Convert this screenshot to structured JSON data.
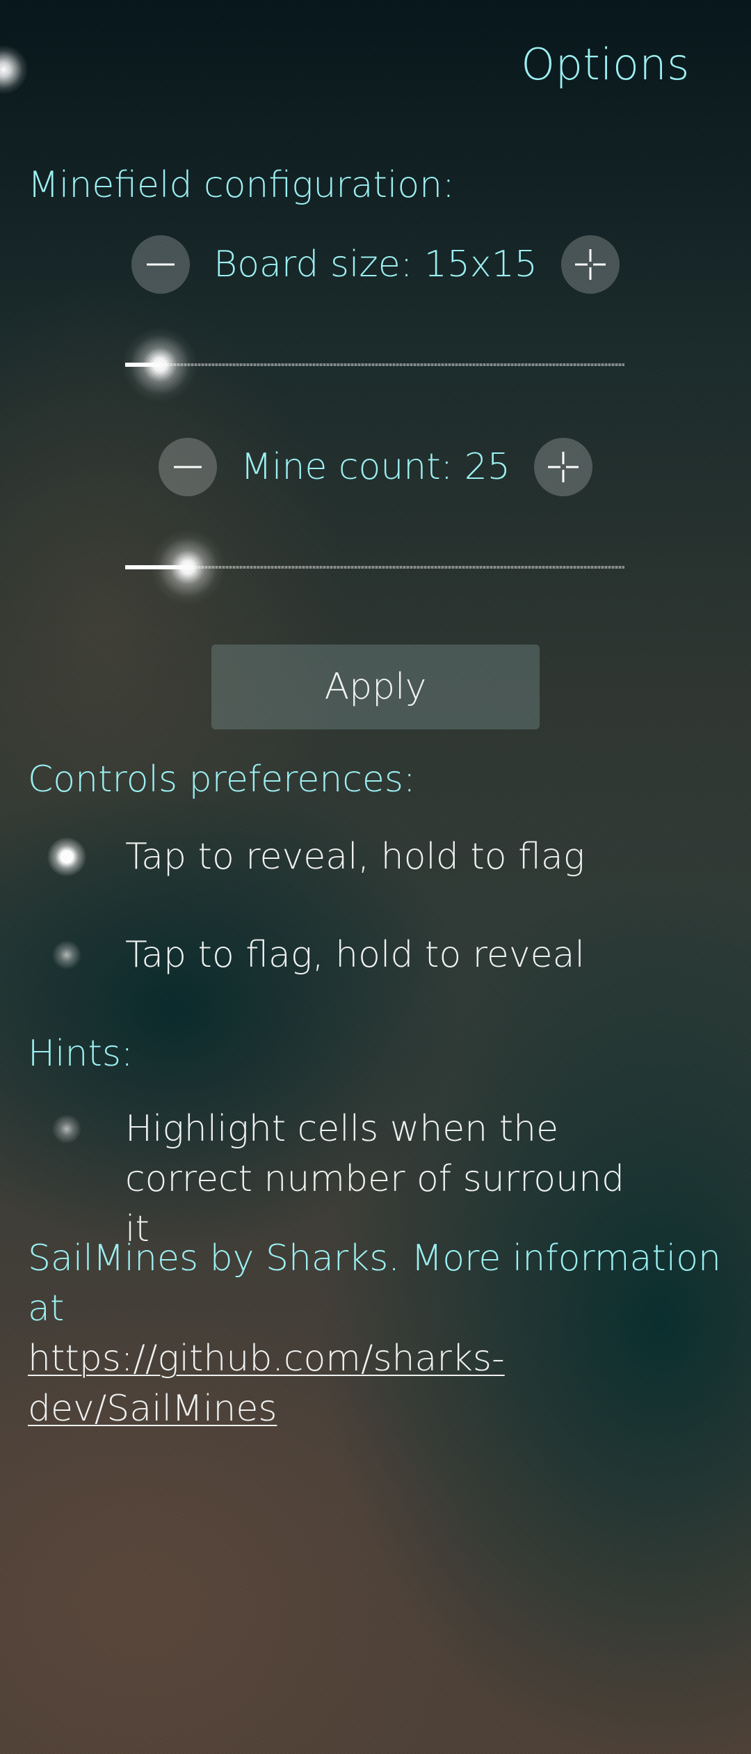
{
  "page": {
    "title": "Options"
  },
  "minefield": {
    "header": "Minefield configuration:",
    "board_size_label": "Board size: 15x15",
    "board_size_fraction": 0.07,
    "mine_count_label": "Mine count: 25",
    "mine_count_fraction": 0.125,
    "apply_label": "Apply"
  },
  "controls": {
    "header": "Controls preferences:",
    "options": [
      {
        "label": "Tap to reveal, hold to flag",
        "selected": true
      },
      {
        "label": "Tap to flag, hold to reveal",
        "selected": false
      }
    ]
  },
  "hints": {
    "header": "Hints:",
    "highlight_label": "Highlight cells when the correct number of surround it",
    "highlight_enabled": false
  },
  "footer": {
    "text": "SailMines by Sharks. More information at",
    "link": "https://github.com/sharks-dev/SailMines"
  },
  "colors": {
    "accent": "#9df2f4",
    "text": "#f2f4f3"
  },
  "icons": {
    "decrement": "minus-icon",
    "increment": "plus-icon"
  }
}
